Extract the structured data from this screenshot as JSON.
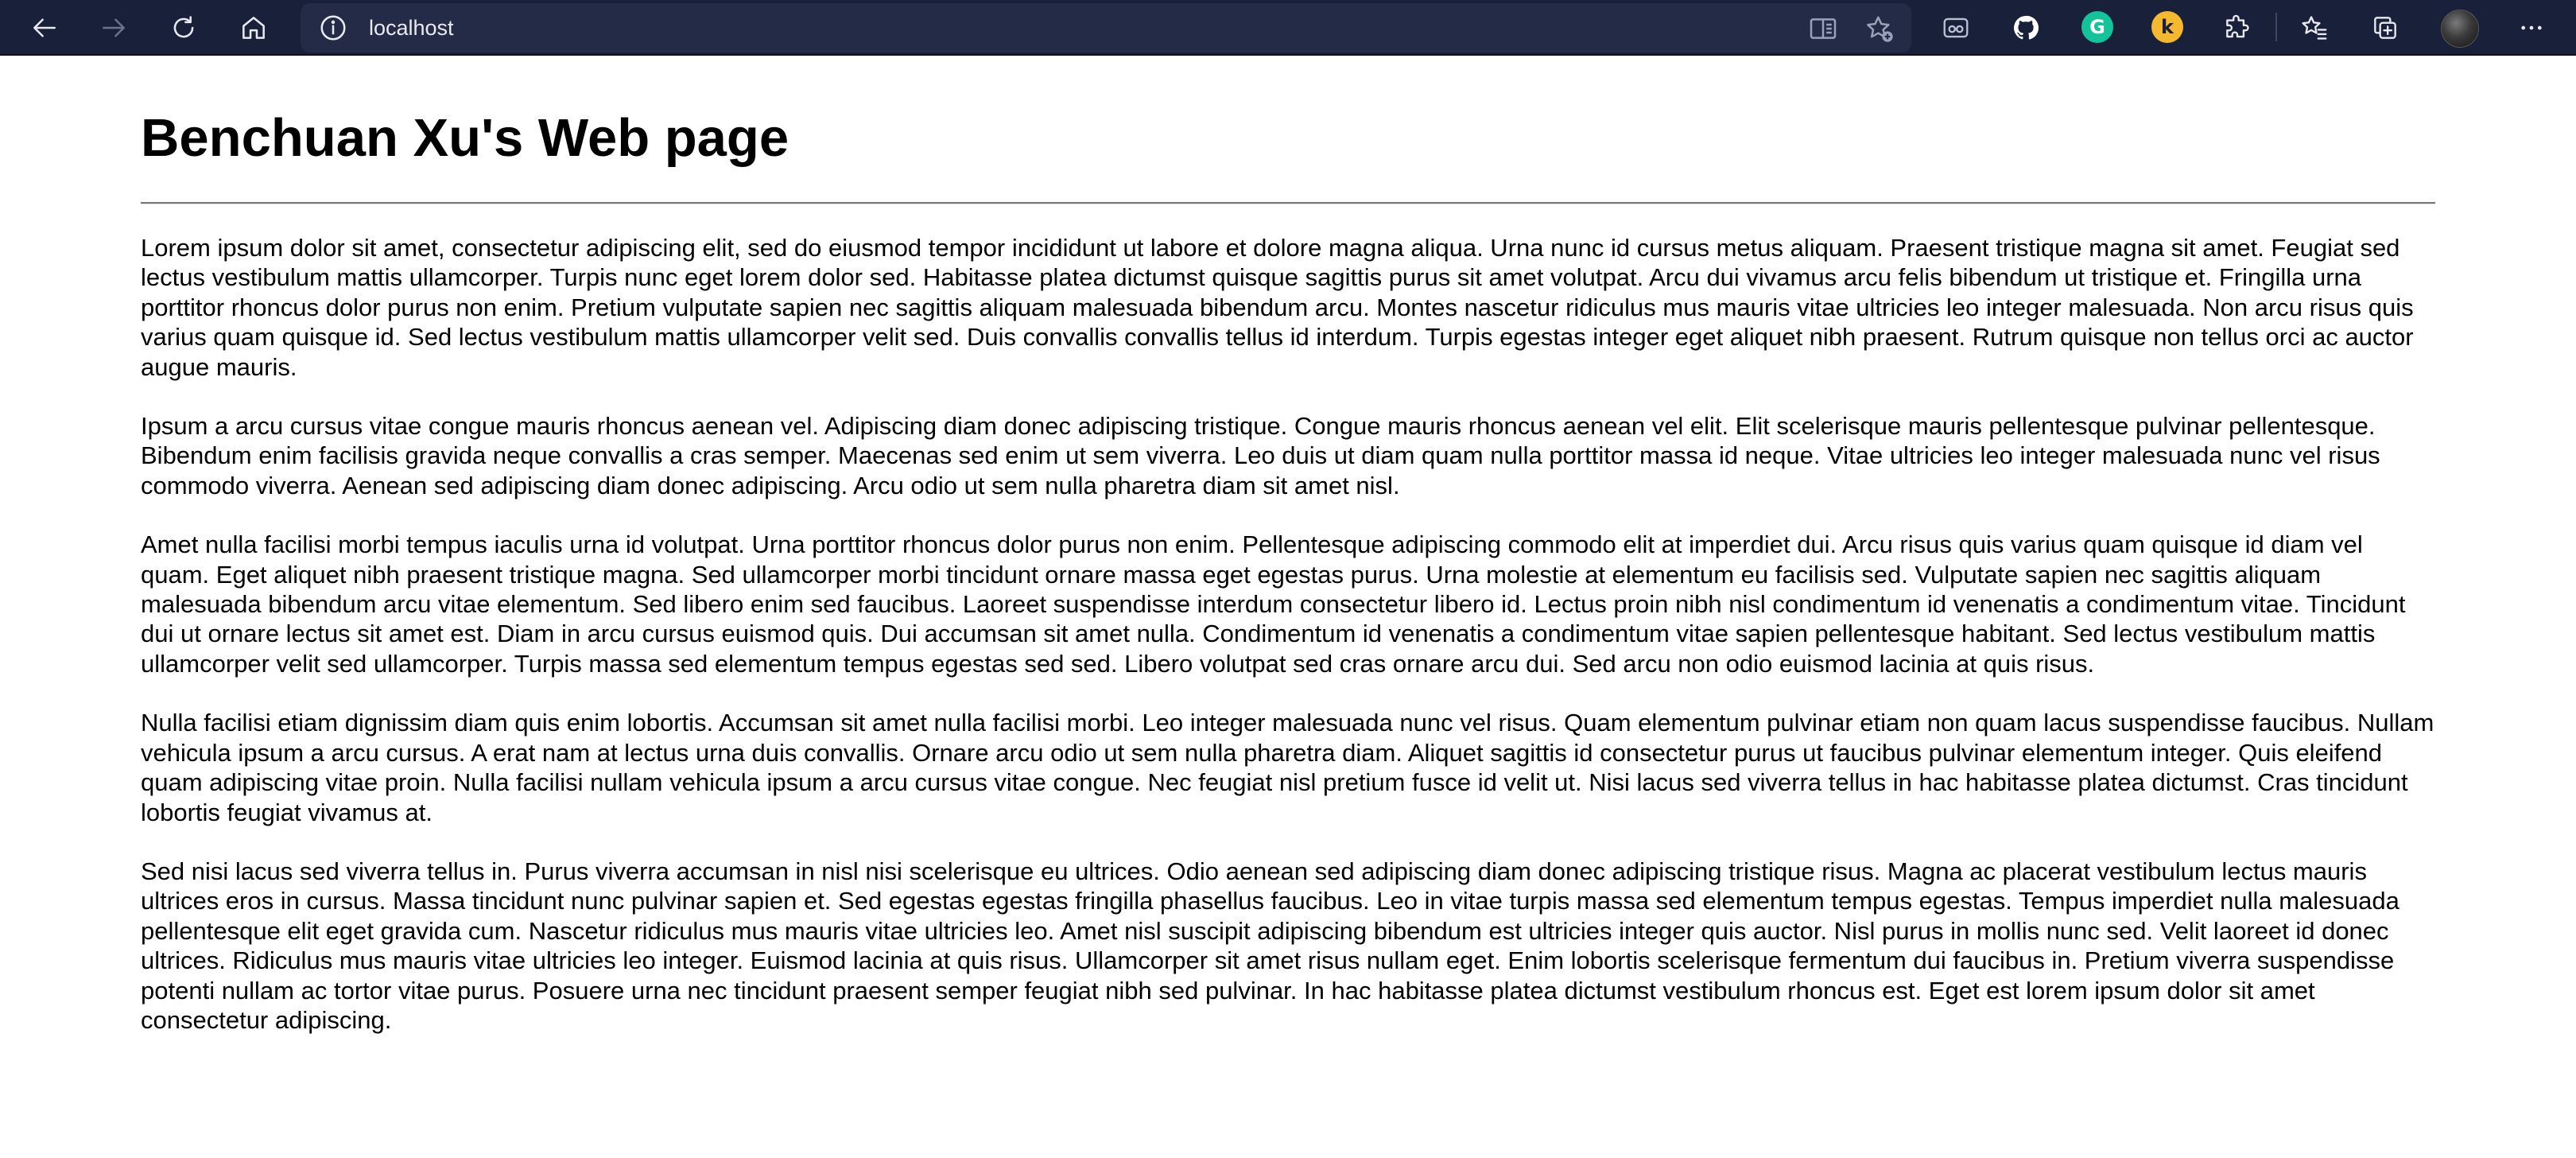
{
  "browser": {
    "address": "localhost",
    "icons": [
      "back-icon",
      "forward-icon",
      "refresh-icon",
      "home-icon",
      "site-info-icon",
      "reader-mode-icon",
      "add-favorite-icon",
      "extension-glasses-icon",
      "github-icon",
      "grammarly-icon",
      "extension-yellow-icon",
      "extensions-icon",
      "favorites-icon",
      "collections-icon",
      "profile-avatar",
      "more-menu-icon"
    ]
  },
  "page": {
    "title": "Benchuan Xu's Web page",
    "paragraphs": [
      "Lorem ipsum dolor sit amet, consectetur adipiscing elit, sed do eiusmod tempor incididunt ut labore et dolore magna aliqua. Urna nunc id cursus metus aliquam. Praesent tristique magna sit amet. Feugiat sed lectus vestibulum mattis ullamcorper. Turpis nunc eget lorem dolor sed. Habitasse platea dictumst quisque sagittis purus sit amet volutpat. Arcu dui vivamus arcu felis bibendum ut tristique et. Fringilla urna porttitor rhoncus dolor purus non enim. Pretium vulputate sapien nec sagittis aliquam malesuada bibendum arcu. Montes nascetur ridiculus mus mauris vitae ultricies leo integer malesuada. Non arcu risus quis varius quam quisque id. Sed lectus vestibulum mattis ullamcorper velit sed. Duis convallis convallis tellus id interdum. Turpis egestas integer eget aliquet nibh praesent. Rutrum quisque non tellus orci ac auctor augue mauris.",
      "Ipsum a arcu cursus vitae congue mauris rhoncus aenean vel. Adipiscing diam donec adipiscing tristique. Congue mauris rhoncus aenean vel elit. Elit scelerisque mauris pellentesque pulvinar pellentesque. Bibendum enim facilisis gravida neque convallis a cras semper. Maecenas sed enim ut sem viverra. Leo duis ut diam quam nulla porttitor massa id neque. Vitae ultricies leo integer malesuada nunc vel risus commodo viverra. Aenean sed adipiscing diam donec adipiscing. Arcu odio ut sem nulla pharetra diam sit amet nisl.",
      "Amet nulla facilisi morbi tempus iaculis urna id volutpat. Urna porttitor rhoncus dolor purus non enim. Pellentesque adipiscing commodo elit at imperdiet dui. Arcu risus quis varius quam quisque id diam vel quam. Eget aliquet nibh praesent tristique magna. Sed ullamcorper morbi tincidunt ornare massa eget egestas purus. Urna molestie at elementum eu facilisis sed. Vulputate sapien nec sagittis aliquam malesuada bibendum arcu vitae elementum. Sed libero enim sed faucibus. Laoreet suspendisse interdum consectetur libero id. Lectus proin nibh nisl condimentum id venenatis a condimentum vitae. Tincidunt dui ut ornare lectus sit amet est. Diam in arcu cursus euismod quis. Dui accumsan sit amet nulla. Condimentum id venenatis a condimentum vitae sapien pellentesque habitant. Sed lectus vestibulum mattis ullamcorper velit sed ullamcorper. Turpis massa sed elementum tempus egestas sed sed. Libero volutpat sed cras ornare arcu dui. Sed arcu non odio euismod lacinia at quis risus.",
      "Nulla facilisi etiam dignissim diam quis enim lobortis. Accumsan sit amet nulla facilisi morbi. Leo integer malesuada nunc vel risus. Quam elementum pulvinar etiam non quam lacus suspendisse faucibus. Nullam vehicula ipsum a arcu cursus. A erat nam at lectus urna duis convallis. Ornare arcu odio ut sem nulla pharetra diam. Aliquet sagittis id consectetur purus ut faucibus pulvinar elementum integer. Quis eleifend quam adipiscing vitae proin. Nulla facilisi nullam vehicula ipsum a arcu cursus vitae congue. Nec feugiat nisl pretium fusce id velit ut. Nisi lacus sed viverra tellus in hac habitasse platea dictumst. Cras tincidunt lobortis feugiat vivamus at.",
      "Sed nisi lacus sed viverra tellus in. Purus viverra accumsan in nisl nisi scelerisque eu ultrices. Odio aenean sed adipiscing diam donec adipiscing tristique risus. Magna ac placerat vestibulum lectus mauris ultrices eros in cursus. Massa tincidunt nunc pulvinar sapien et. Sed egestas egestas fringilla phasellus faucibus. Leo in vitae turpis massa sed elementum tempus egestas. Tempus imperdiet nulla malesuada pellentesque elit eget gravida cum. Nascetur ridiculus mus mauris vitae ultricies leo. Amet nisl suscipit adipiscing bibendum est ultricies integer quis auctor. Nisl purus in mollis nunc sed. Velit laoreet id donec ultrices. Ridiculus mus mauris vitae ultricies leo integer. Euismod lacinia at quis risus. Ullamcorper sit amet risus nullam eget. Enim lobortis scelerisque fermentum dui faucibus in. Pretium viverra suspendisse potenti nullam ac tortor vitae purus. Posuere urna nec tincidunt praesent semper feugiat nibh sed pulvinar. In hac habitasse platea dictumst vestibulum rhoncus est. Eget est lorem ipsum dolor sit amet consectetur adipiscing."
    ]
  },
  "colors": {
    "toolbar_bg": "#19203a",
    "address_bg": "#232b47",
    "grammarly": "#15c39a",
    "yellow_ext": "#f5b82e"
  }
}
